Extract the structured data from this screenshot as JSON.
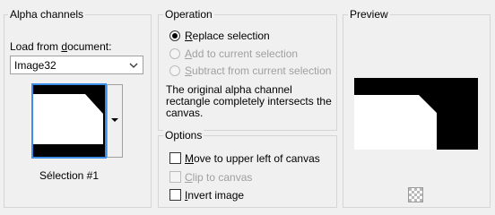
{
  "alpha_channels": {
    "title": "Alpha channels",
    "load_label_pre": "Load from ",
    "load_label_u": "d",
    "load_label_post": "ocument:",
    "document_value": "Image32",
    "selection_caption": "Sélection #1"
  },
  "operation": {
    "title": "Operation",
    "options": [
      {
        "u": "R",
        "rest": "eplace selection",
        "checked": true,
        "enabled": true
      },
      {
        "u": "A",
        "rest": "dd to current selection",
        "checked": false,
        "enabled": false
      },
      {
        "u": "S",
        "rest": "ubtract from current selection",
        "checked": false,
        "enabled": false
      }
    ],
    "description_line1": "The original alpha channel",
    "description_line2": "rectangle completely intersects the",
    "description_line3": "canvas."
  },
  "options": {
    "title": "Options",
    "items": [
      {
        "u": "M",
        "rest": "ove to upper left of canvas",
        "checked": false,
        "enabled": true
      },
      {
        "u": "C",
        "rest": "lip to canvas",
        "checked": false,
        "enabled": false
      },
      {
        "u": "I",
        "rest": "nvert image",
        "checked": false,
        "enabled": true
      }
    ]
  },
  "preview": {
    "title": "Preview",
    "icon": "checkerboard-icon"
  }
}
